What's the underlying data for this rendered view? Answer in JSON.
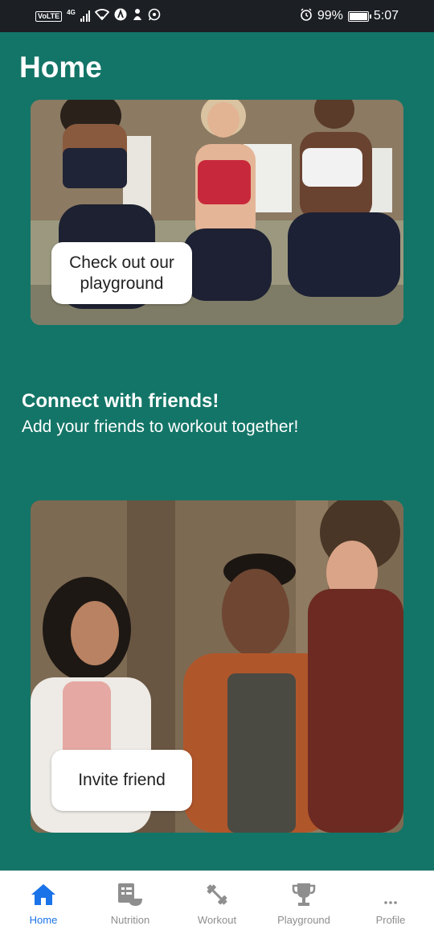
{
  "status_bar": {
    "volte": "VoLTE",
    "network": "4G",
    "battery": "99%",
    "time": "5:07"
  },
  "header": {
    "title": "Home"
  },
  "cards": [
    {
      "button_label": "Check out our playground",
      "photo": "women-workout-photo"
    },
    {
      "button_label": "Invite friend",
      "photo": "friends-laughing-photo"
    }
  ],
  "connect": {
    "title": "Connect with friends!",
    "subtitle": "Add your friends to workout together!"
  },
  "bottom_nav": {
    "items": [
      {
        "label": "Home",
        "icon": "home-icon",
        "active": true
      },
      {
        "label": "Nutrition",
        "icon": "nutrition-icon",
        "active": false
      },
      {
        "label": "Workout",
        "icon": "dumbbell-icon",
        "active": false
      },
      {
        "label": "Playground",
        "icon": "trophy-icon",
        "active": false
      },
      {
        "label": "Profile",
        "icon": "more-icon",
        "active": false
      }
    ]
  },
  "colors": {
    "background": "#137567",
    "status_bar": "#1c1f24",
    "active_nav": "#1a73e8",
    "inactive_nav": "#8e8e8e"
  }
}
